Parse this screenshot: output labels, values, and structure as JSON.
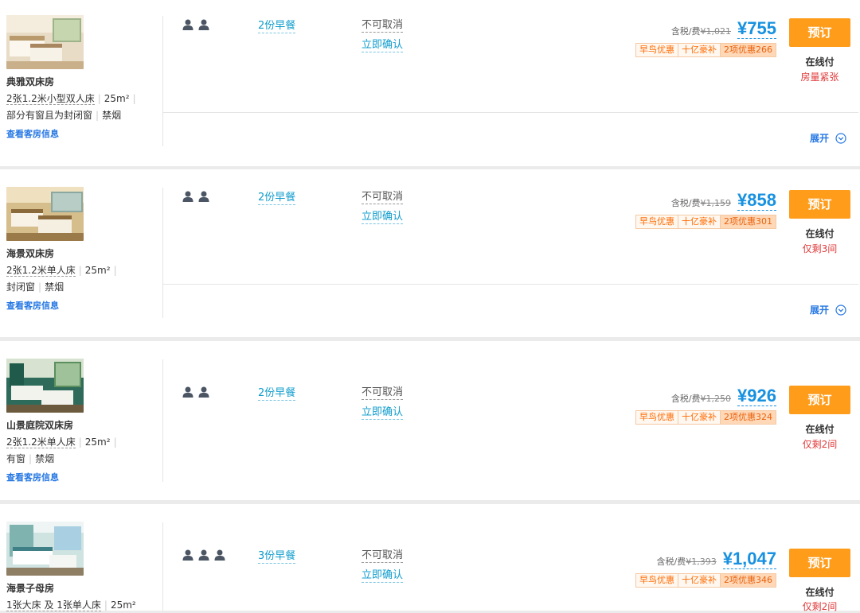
{
  "rooms": [
    {
      "name": "典雅双床房",
      "bed": "2张1.2米小型双人床",
      "area": "25m²",
      "extra1": "部分有窗且为封闭窗",
      "extra2": "禁烟",
      "link": "查看客房信息",
      "guests": 2,
      "breakfast": "2份早餐",
      "cancel": "不可取消",
      "confirm": "立即确认",
      "orig_label": "含税/费",
      "orig_price": "¥1,021",
      "price": "¥755",
      "tag1": "早鸟优惠",
      "tag2": "十亿豪补",
      "tag3": "2项优惠266",
      "book": "预订",
      "pay": "在线付",
      "stock": "房量紧张",
      "expand": "展开",
      "image_theme": "beige"
    },
    {
      "name": "海景双床房",
      "bed": "2张1.2米单人床",
      "area": "25m²",
      "extra1": "封闭窗",
      "extra2": "禁烟",
      "link": "查看客房信息",
      "guests": 2,
      "breakfast": "2份早餐",
      "cancel": "不可取消",
      "confirm": "立即确认",
      "orig_label": "含税/费",
      "orig_price": "¥1,159",
      "price": "¥858",
      "tag1": "早鸟优惠",
      "tag2": "十亿豪补",
      "tag3": "2项优惠301",
      "book": "预订",
      "pay": "在线付",
      "stock": "仅剩3间",
      "expand": "展开",
      "image_theme": "gold"
    },
    {
      "name": "山景庭院双床房",
      "bed": "2张1.2米单人床",
      "area": "25m²",
      "extra1": "有窗",
      "extra2": "禁烟",
      "link": "查看客房信息",
      "guests": 2,
      "breakfast": "2份早餐",
      "cancel": "不可取消",
      "confirm": "立即确认",
      "orig_label": "含税/费",
      "orig_price": "¥1,250",
      "price": "¥926",
      "tag1": "早鸟优惠",
      "tag2": "十亿豪补",
      "tag3": "2项优惠324",
      "book": "预订",
      "pay": "在线付",
      "stock": "仅剩2间",
      "image_theme": "green"
    },
    {
      "name": "海景子母房",
      "bed": "1张大床 及 1张单人床",
      "area": "25m²",
      "guests": 3,
      "breakfast": "3份早餐",
      "cancel": "不可取消",
      "confirm": "立即确认",
      "orig_label": "含税/费",
      "orig_price": "¥1,393",
      "price": "¥1,047",
      "tag1": "早鸟优惠",
      "tag2": "十亿豪补",
      "tag3": "2项优惠346",
      "book": "预订",
      "pay": "在线付",
      "stock": "仅剩2间",
      "image_theme": "teal"
    }
  ],
  "colors": {
    "price_blue": "#1791e0",
    "book_orange": "#ff9c1a",
    "link_blue": "#2577e3",
    "stock_red": "#e03a3a"
  }
}
